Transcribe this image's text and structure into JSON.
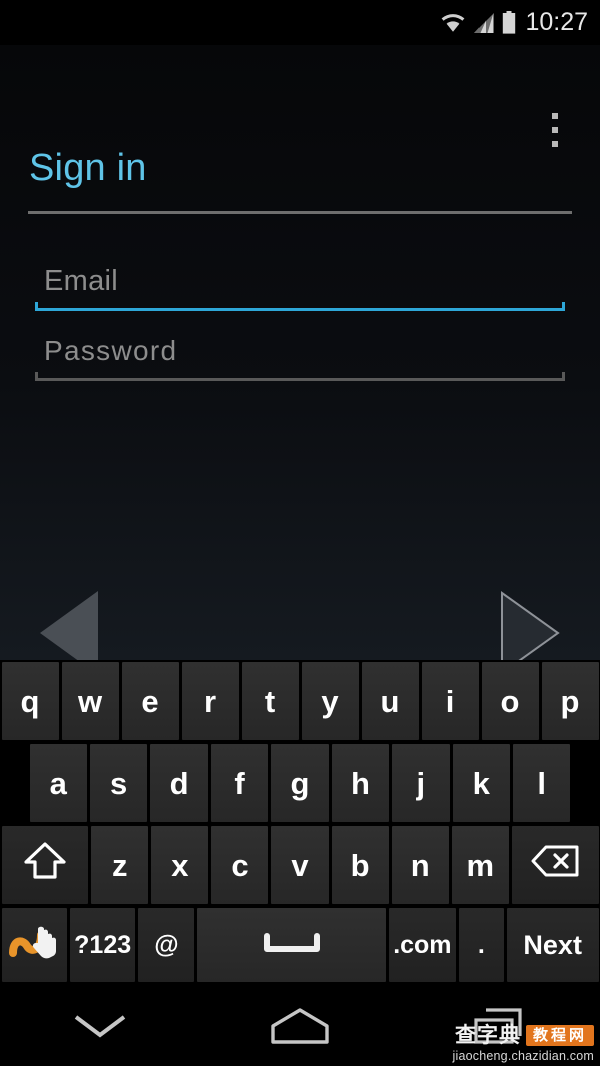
{
  "status_bar": {
    "clock": "10:27",
    "icons": [
      "wifi-icon",
      "cellular-signal-icon",
      "battery-icon"
    ]
  },
  "app": {
    "title": "Sign in",
    "title_color": "#5fc4e8",
    "overflow_menu": "overflow-menu-icon"
  },
  "form": {
    "email": {
      "label": "Email",
      "placeholder": "Email",
      "value": "",
      "focused": true,
      "underline_color": "#2ea7d8"
    },
    "password": {
      "label": "Password",
      "placeholder": "Password",
      "value": "",
      "focused": false,
      "underline_color": "#595959"
    }
  },
  "navigation": {
    "back_arrow": "arrow-left-icon",
    "forward_arrow": "arrow-right-icon"
  },
  "keyboard": {
    "rows": [
      [
        {
          "label": "q",
          "name": "key-q"
        },
        {
          "label": "w",
          "name": "key-w"
        },
        {
          "label": "e",
          "name": "key-e"
        },
        {
          "label": "r",
          "name": "key-r"
        },
        {
          "label": "t",
          "name": "key-t"
        },
        {
          "label": "y",
          "name": "key-y"
        },
        {
          "label": "u",
          "name": "key-u"
        },
        {
          "label": "i",
          "name": "key-i"
        },
        {
          "label": "o",
          "name": "key-o"
        },
        {
          "label": "p",
          "name": "key-p"
        }
      ],
      [
        {
          "label": "a",
          "name": "key-a"
        },
        {
          "label": "s",
          "name": "key-s"
        },
        {
          "label": "d",
          "name": "key-d"
        },
        {
          "label": "f",
          "name": "key-f"
        },
        {
          "label": "g",
          "name": "key-g"
        },
        {
          "label": "h",
          "name": "key-h"
        },
        {
          "label": "j",
          "name": "key-j"
        },
        {
          "label": "k",
          "name": "key-k"
        },
        {
          "label": "l",
          "name": "key-l"
        }
      ],
      [
        {
          "label": "",
          "name": "key-shift",
          "icon": "shift-arrow-up-icon"
        },
        {
          "label": "z",
          "name": "key-z"
        },
        {
          "label": "x",
          "name": "key-x"
        },
        {
          "label": "c",
          "name": "key-c"
        },
        {
          "label": "v",
          "name": "key-v"
        },
        {
          "label": "b",
          "name": "key-b"
        },
        {
          "label": "n",
          "name": "key-n"
        },
        {
          "label": "m",
          "name": "key-m"
        },
        {
          "label": "",
          "name": "key-backspace",
          "icon": "backspace-icon"
        }
      ],
      [
        {
          "label": "",
          "name": "key-gesture-typing",
          "icon": "gesture-swipe-hand-icon"
        },
        {
          "label": "?123",
          "name": "key-symbols"
        },
        {
          "label": "@",
          "name": "key-at-sign"
        },
        {
          "label": "",
          "name": "key-space",
          "icon": "spacebar-icon"
        },
        {
          "label": ".com",
          "name": "key-dot-com"
        },
        {
          "label": ".",
          "name": "key-period"
        },
        {
          "label": "Next",
          "name": "key-next"
        }
      ]
    ]
  },
  "system_nav": {
    "back": "chevron-down-hide-keyboard-icon",
    "home": "home-pentagon-icon",
    "recents": "recent-apps-icon"
  },
  "watermark": {
    "brand_cn": "查字典",
    "badge_cn": "教程网",
    "url": "jiaocheng.chazidian.com",
    "badge_color": "#e2751d"
  }
}
